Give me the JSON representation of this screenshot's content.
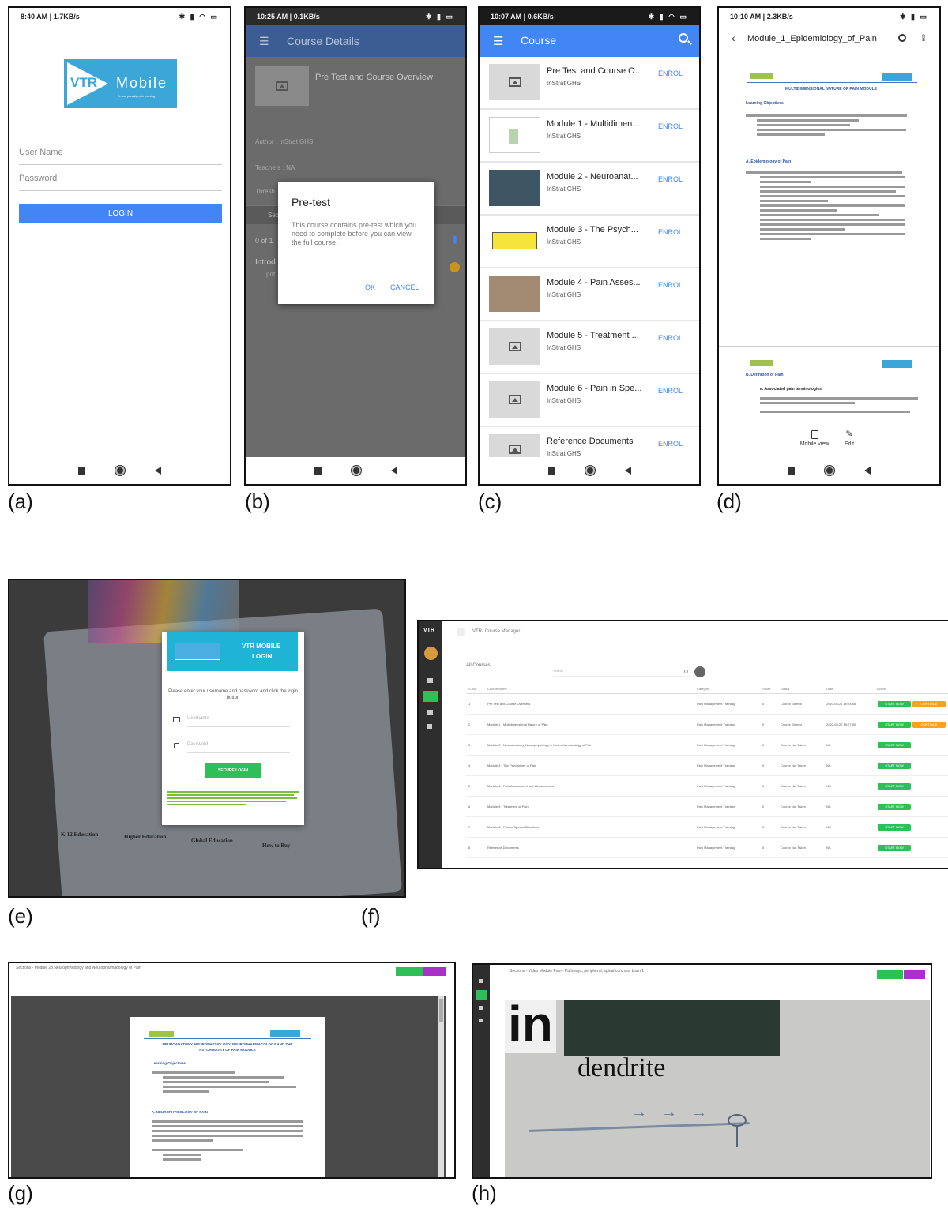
{
  "captions": [
    "(a)",
    "(b)",
    "(c)",
    "(d)",
    "(e)",
    "(f)",
    "(g)",
    "(h)"
  ],
  "a": {
    "status_left": "8:40 AM | 1.7KB/s",
    "logo_vtr": "VTR",
    "logo_mobile": "Mobile",
    "logo_tagline": "A new paradigm in training",
    "username_placeholder": "User Name",
    "password_placeholder": "Password",
    "login_label": "LOGIN"
  },
  "b": {
    "status_left": "10:25 AM | 0.1KB/s",
    "title": "Course Details",
    "course_title": "Pre Test and Course Overview",
    "author": "Author : InStrat GHS",
    "teachers": "Teachers : NA",
    "threshold": "Thresh",
    "sections_label": "Sec",
    "progress": "0 of 1",
    "intro_label": "Introd",
    "pdf_label": "pdf",
    "dialog_title": "Pre-test",
    "dialog_body": "This course contains pre-test which you need to complete before you can view the full course.",
    "dialog_ok": "OK",
    "dialog_cancel": "CANCEL"
  },
  "c": {
    "status_left": "10:07 AM | 0.6KB/s",
    "title": "Course",
    "enrol_label": "ENROL",
    "courses": [
      {
        "title": "Pre Test and Course O...",
        "sub": "InStrat GHS"
      },
      {
        "title": "Module 1 - Multidimen...",
        "sub": "InStrat GHS"
      },
      {
        "title": "Module 2 - Neuroanat...",
        "sub": "InStrat GHS"
      },
      {
        "title": "Module 3 - The Psych...",
        "sub": "InStrat GHS"
      },
      {
        "title": "Module 4 - Pain Asses...",
        "sub": "InStrat GHS"
      },
      {
        "title": "Module 5 - Treatment ...",
        "sub": "InStrat GHS"
      },
      {
        "title": "Module 6 - Pain in Spe...",
        "sub": "InStrat GHS"
      },
      {
        "title": "Reference Documents",
        "sub": "InStrat GHS"
      }
    ]
  },
  "d": {
    "status_left": "10:10 AM | 2.3KB/s",
    "title": "Module_1_Epidemiology_of_Pain",
    "doc_heading": "MULTIDIMENSIONAL NATURE OF PAIN MODULE",
    "learning_objectives": "Learning Objectives",
    "section_a": "A. Epidemiology of Pain",
    "section_b": "B. Definition of Pain",
    "sub_a": "a. Associated pain terminologies",
    "mobile_view": "Mobile view",
    "edit": "Edit"
  },
  "e": {
    "header_title": "VTR MOBILE",
    "header_sub": "LOGIN",
    "prompt": "Please enter your username and password and click the login button",
    "username_placeholder": "Username",
    "password_placeholder": "Password",
    "button": "SECURE LOGIN",
    "bg_headings": [
      "K-12 Education",
      "Higher Education",
      "Global Education",
      "How to Buy"
    ]
  },
  "f": {
    "logo": "VTR",
    "title": "VTR- Course Manager",
    "section": "All Courses",
    "search_placeholder": "Search",
    "columns": [
      "S. No.",
      "Course Name",
      "Category",
      "Score",
      "Status",
      "Date",
      "Action"
    ],
    "start_label": "START NOW",
    "continue_label": "CONTINUE",
    "rows": [
      {
        "no": "1",
        "name": "Pre Test and Course Overview",
        "cat": "Pain Management Training",
        "score": "0",
        "status": "Course Started",
        "date": "2020-05-27 19:24:55",
        "cont": true
      },
      {
        "no": "2",
        "name": "Module 1 - Multidimensional Nature of Pain",
        "cat": "Pain Management Training",
        "score": "0",
        "status": "Course Started",
        "date": "2020-05-27 19:27:50",
        "cont": true
      },
      {
        "no": "3",
        "name": "Module 2 - Neuroanatomy, Neurophysiology & Neuropharmacology of Pain",
        "cat": "Pain Management Training",
        "score": "0",
        "status": "Course Not Taken",
        "date": "NA",
        "cont": false
      },
      {
        "no": "4",
        "name": "Module 3 - The Psychology of Pain",
        "cat": "Pain Management Training",
        "score": "0",
        "status": "Course Not Taken",
        "date": "NA",
        "cont": false
      },
      {
        "no": "5",
        "name": "Module 4 - Pain Assessment and Measurement",
        "cat": "Pain Management Training",
        "score": "0",
        "status": "Course Not Taken",
        "date": "NA",
        "cont": false
      },
      {
        "no": "6",
        "name": "Module 5 - Treatment of Pain",
        "cat": "Pain Management Training",
        "score": "0",
        "status": "Course Not Taken",
        "date": "NA",
        "cont": false
      },
      {
        "no": "7",
        "name": "Module 6 - Pain in Special Situations",
        "cat": "Pain Management Training",
        "score": "0",
        "status": "Course Not Taken",
        "date": "NA",
        "cont": false
      },
      {
        "no": "8",
        "name": "Reference Documents",
        "cat": "Pain Management Training",
        "score": "0",
        "status": "Course Not Taken",
        "date": "NA",
        "cont": false
      }
    ]
  },
  "g": {
    "title": "Sections - Module 2b Neurophysiology and Neuropharmacology of Pain",
    "doc_heading": "NEUROANATOMY, NEUROPHYSIOLOGY, NEUROPHARMACOLOGY AND THE PSYCHOLOGY OF PAIN MODULE",
    "learning_objectives": "Learning Objectives",
    "section_a": "A. NEUROPHYSIOLOGY OF PAIN"
  },
  "h": {
    "title": "Sections - Video Module Pain - Pathways, peripheral, spinal cord and brain 1",
    "board_text_1": "in",
    "board_text_2": "dendrite"
  }
}
